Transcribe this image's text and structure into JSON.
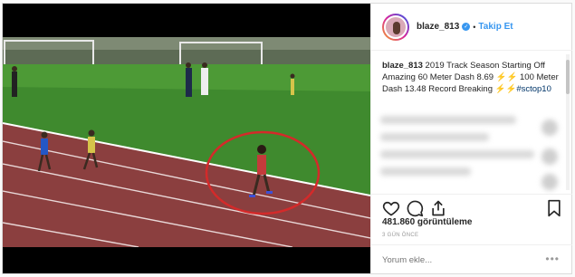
{
  "post": {
    "username": "blaze_813",
    "follow_label": "Takip Et",
    "separator": "•",
    "caption": {
      "username": "blaze_813",
      "line1": "2019 Track Season Starting Off Amazing 60 Meter Dash 8.69",
      "line2": "100 Meter Dash 13.48 Record Breaking",
      "hashtag": "#sctop10"
    },
    "views": "481.860 görüntüleme",
    "time": "3 GÜN ÖNCE",
    "comment_placeholder": "Yorum ekle...",
    "more_label": "•••"
  },
  "colors": {
    "accent": "#3897f0",
    "track": "#8b3f3f",
    "grass": "#3f8a2e",
    "highlight_circle": "#d42a2a"
  },
  "icons": [
    "verified-icon",
    "heart-icon",
    "comment-icon",
    "share-icon",
    "bookmark-icon",
    "lightning-icon"
  ]
}
